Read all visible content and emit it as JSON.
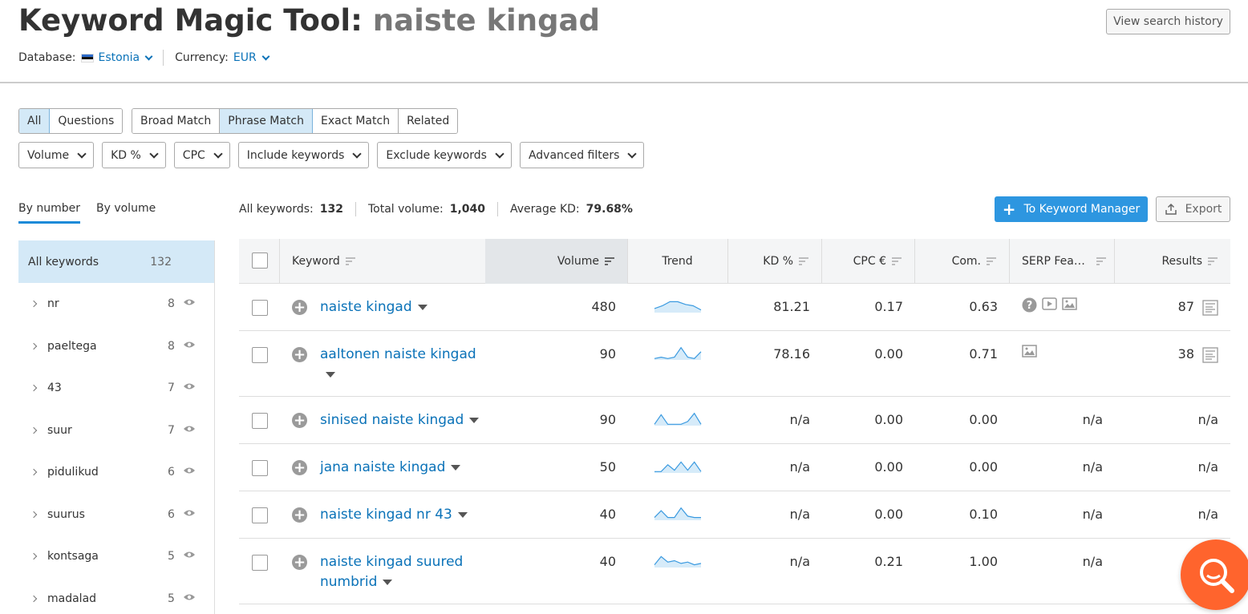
{
  "header": {
    "title_prefix": "Keyword Magic Tool:",
    "query": "naiste kingad",
    "database_label": "Database:",
    "database_value": "Estonia",
    "currency_label": "Currency:",
    "currency_value": "EUR",
    "history_button": "View search history"
  },
  "segments": {
    "group1": [
      "All",
      "Questions"
    ],
    "group2": [
      "Broad Match",
      "Phrase Match",
      "Exact Match",
      "Related"
    ]
  },
  "filters": [
    "Volume",
    "KD %",
    "CPC",
    "Include keywords",
    "Exclude keywords",
    "Advanced filters"
  ],
  "left": {
    "tab_number": "By number",
    "tab_volume": "By volume",
    "all_label": "All keywords",
    "all_count": "132",
    "groups": [
      {
        "name": "nr",
        "count": "8"
      },
      {
        "name": "paeltega",
        "count": "8"
      },
      {
        "name": "43",
        "count": "7"
      },
      {
        "name": "suur",
        "count": "7"
      },
      {
        "name": "pidulikud",
        "count": "6"
      },
      {
        "name": "suurus",
        "count": "6"
      },
      {
        "name": "kontsaga",
        "count": "5"
      },
      {
        "name": "madalad",
        "count": "5"
      }
    ]
  },
  "summary": {
    "all_label": "All keywords:",
    "all_value": "132",
    "vol_label": "Total volume:",
    "vol_value": "1,040",
    "kd_label": "Average KD:",
    "kd_value": "79.68%"
  },
  "actions": {
    "km_button": "To Keyword Manager",
    "export_button": "Export"
  },
  "columns": {
    "keyword": "Keyword",
    "volume": "Volume",
    "trend": "Trend",
    "kd": "KD %",
    "cpc": "CPC €",
    "com": "Com.",
    "serp": "SERP Fea…",
    "results": "Results"
  },
  "rows": [
    {
      "keyword": "naiste kingad",
      "volume": "480",
      "kd": "81.21",
      "cpc": "0.17",
      "com": "0.63",
      "serp": "",
      "results": "87",
      "trend": [
        0.3,
        0.5,
        0.8,
        0.8,
        0.6,
        0.5,
        0.2
      ]
    },
    {
      "keyword": "aaltonen naiste kingad",
      "volume": "90",
      "kd": "78.16",
      "cpc": "0.00",
      "com": "0.71",
      "serp": "",
      "results": "38",
      "trend": [
        0.1,
        0.2,
        0.1,
        0.2,
        0.9,
        0.2,
        0.1,
        0.6
      ]
    },
    {
      "keyword": "sinised naiste kingad",
      "volume": "90",
      "kd": "n/a",
      "cpc": "0.00",
      "com": "0.00",
      "serp": "n/a",
      "results": "n/a",
      "trend": [
        0.1,
        0.8,
        0.1,
        0.1,
        0.1,
        0.3,
        0.9,
        0.1
      ]
    },
    {
      "keyword": "jana naiste kingad",
      "volume": "50",
      "kd": "n/a",
      "cpc": "0.00",
      "com": "0.00",
      "serp": "n/a",
      "results": "n/a",
      "trend": [
        0.1,
        0.1,
        0.6,
        0.2,
        0.8,
        0.2,
        0.8,
        0.1
      ]
    },
    {
      "keyword": "naiste kingad nr 43",
      "volume": "40",
      "kd": "n/a",
      "cpc": "0.00",
      "com": "0.10",
      "serp": "n/a",
      "results": "n/a",
      "trend": [
        0.2,
        0.7,
        0.2,
        0.2,
        0.9,
        0.3,
        0.2,
        0.2
      ]
    },
    {
      "keyword": "naiste kingad suured numbrid",
      "volume": "40",
      "kd": "n/a",
      "cpc": "0.21",
      "com": "1.00",
      "serp": "n/a",
      "results": "",
      "trend": [
        0.2,
        0.8,
        0.4,
        0.5,
        0.3,
        0.4,
        0.2,
        0.3
      ]
    }
  ],
  "colors": {
    "accent": "#2d96e0",
    "link": "#0a72b8",
    "active_bg": "#d4e9f7",
    "fab": "#ff642d"
  }
}
